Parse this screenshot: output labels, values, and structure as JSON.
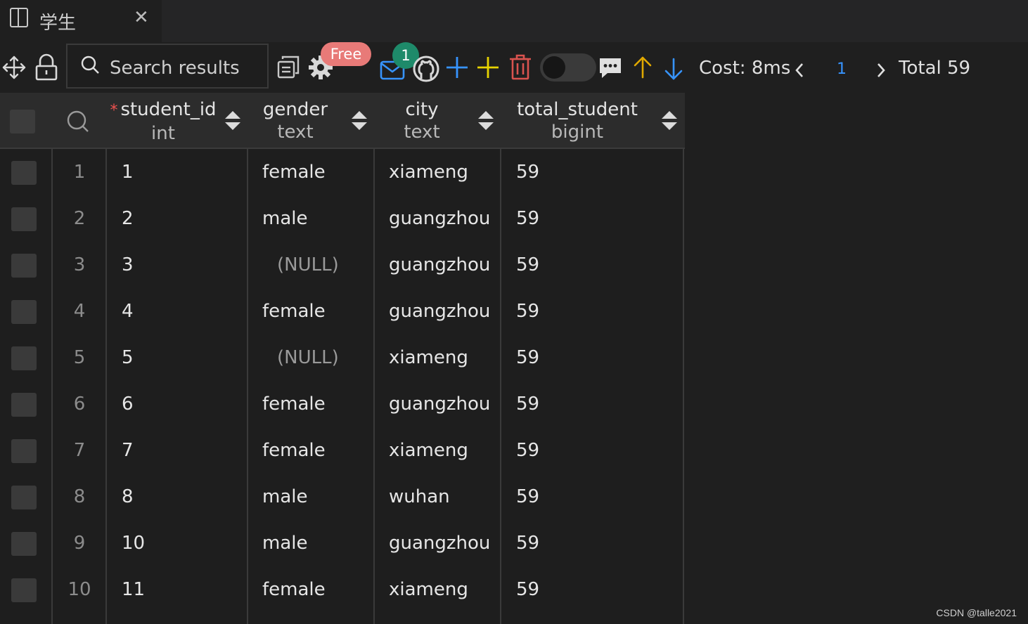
{
  "tab": {
    "title": "学生",
    "close_glyph": "✕"
  },
  "toolbar": {
    "search_placeholder": "Search results",
    "free_badge": "Free",
    "mail_badge_count": "1",
    "cost_label": "Cost: 8ms",
    "current_page": "1",
    "total_label": "Total 59",
    "icons": [
      "move-icon",
      "lock-icon",
      "search-icon",
      "copy-icon",
      "gear-icon",
      "mail-icon",
      "github-icon",
      "add-row-icon",
      "add-column-icon",
      "delete-icon",
      "toggle",
      "comment-icon",
      "arrow-up-icon",
      "arrow-down-icon",
      "chevron-left-icon",
      "chevron-right-icon"
    ],
    "colors": {
      "add_blue": "#3794ff",
      "add_yellow": "#e8d400",
      "delete_red": "#d9534f",
      "up_arrow": "#e0a800",
      "down_arrow": "#3794ff"
    }
  },
  "columns": [
    {
      "name": "student_id",
      "type": "int",
      "required": true,
      "required_mark": "*"
    },
    {
      "name": "gender",
      "type": "text"
    },
    {
      "name": "city",
      "type": "text"
    },
    {
      "name": "total_student",
      "type": "bigint"
    }
  ],
  "rows": [
    {
      "num": "1",
      "student_id": "1",
      "gender": "female",
      "city": "xiameng",
      "total_student": "59"
    },
    {
      "num": "2",
      "student_id": "2",
      "gender": "male",
      "city": "guangzhou",
      "total_student": "59"
    },
    {
      "num": "3",
      "student_id": "3",
      "gender": "(NULL)",
      "city": "guangzhou",
      "total_student": "59"
    },
    {
      "num": "4",
      "student_id": "4",
      "gender": "female",
      "city": "guangzhou",
      "total_student": "59"
    },
    {
      "num": "5",
      "student_id": "5",
      "gender": "(NULL)",
      "city": "xiameng",
      "total_student": "59"
    },
    {
      "num": "6",
      "student_id": "6",
      "gender": "female",
      "city": "guangzhou",
      "total_student": "59"
    },
    {
      "num": "7",
      "student_id": "7",
      "gender": "female",
      "city": "xiameng",
      "total_student": "59"
    },
    {
      "num": "8",
      "student_id": "8",
      "gender": "male",
      "city": "wuhan",
      "total_student": "59"
    },
    {
      "num": "9",
      "student_id": "10",
      "gender": "male",
      "city": "guangzhou",
      "total_student": "59"
    },
    {
      "num": "10",
      "student_id": "11",
      "gender": "female",
      "city": "xiameng",
      "total_student": "59"
    }
  ],
  "watermark": "CSDN @talle2021"
}
